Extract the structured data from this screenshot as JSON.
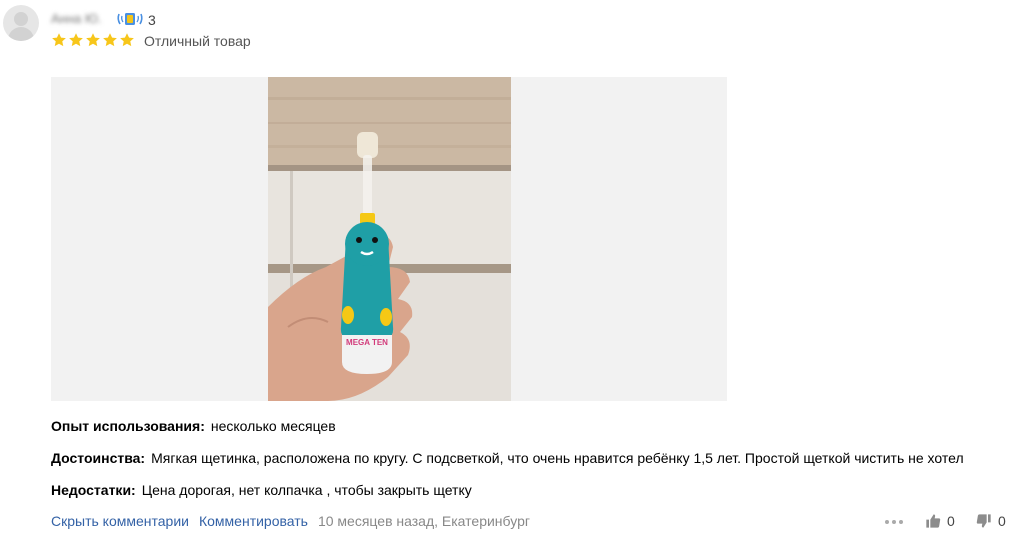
{
  "review": {
    "author": "Анна Ю.",
    "review_count": "3",
    "rating_label": "Отличный товар",
    "rating_stars": 5,
    "photo_brand": "MEGA TEN",
    "experience_label": "Опыт использования:",
    "experience_value": "несколько месяцев",
    "pros_label": "Достоинства:",
    "pros_value": "Мягкая щетинка, расположена по кругу. С подсветкой, что очень нравится ребёнку 1,5 лет. Простой щеткой чистить не хотел",
    "cons_label": "Недостатки:",
    "cons_value": "Цена дорогая, нет колпачка , чтобы закрыть щетку"
  },
  "footer": {
    "hide_comments": "Скрыть комментарии",
    "comment": "Комментировать",
    "meta": "10 месяцев назад, Екатеринбург",
    "likes": "0",
    "dislikes": "0"
  },
  "colors": {
    "star": "#f7c61a",
    "link": "#3462a6",
    "badge_blue": "#4a90e2",
    "badge_gold": "#f5c518",
    "icon_gray": "#8c8c8c"
  },
  "icons": [
    "avatar",
    "reviewer-badge-icon",
    "star-icon",
    "more-dots-icon",
    "thumbs-up-icon",
    "thumbs-down-icon"
  ]
}
